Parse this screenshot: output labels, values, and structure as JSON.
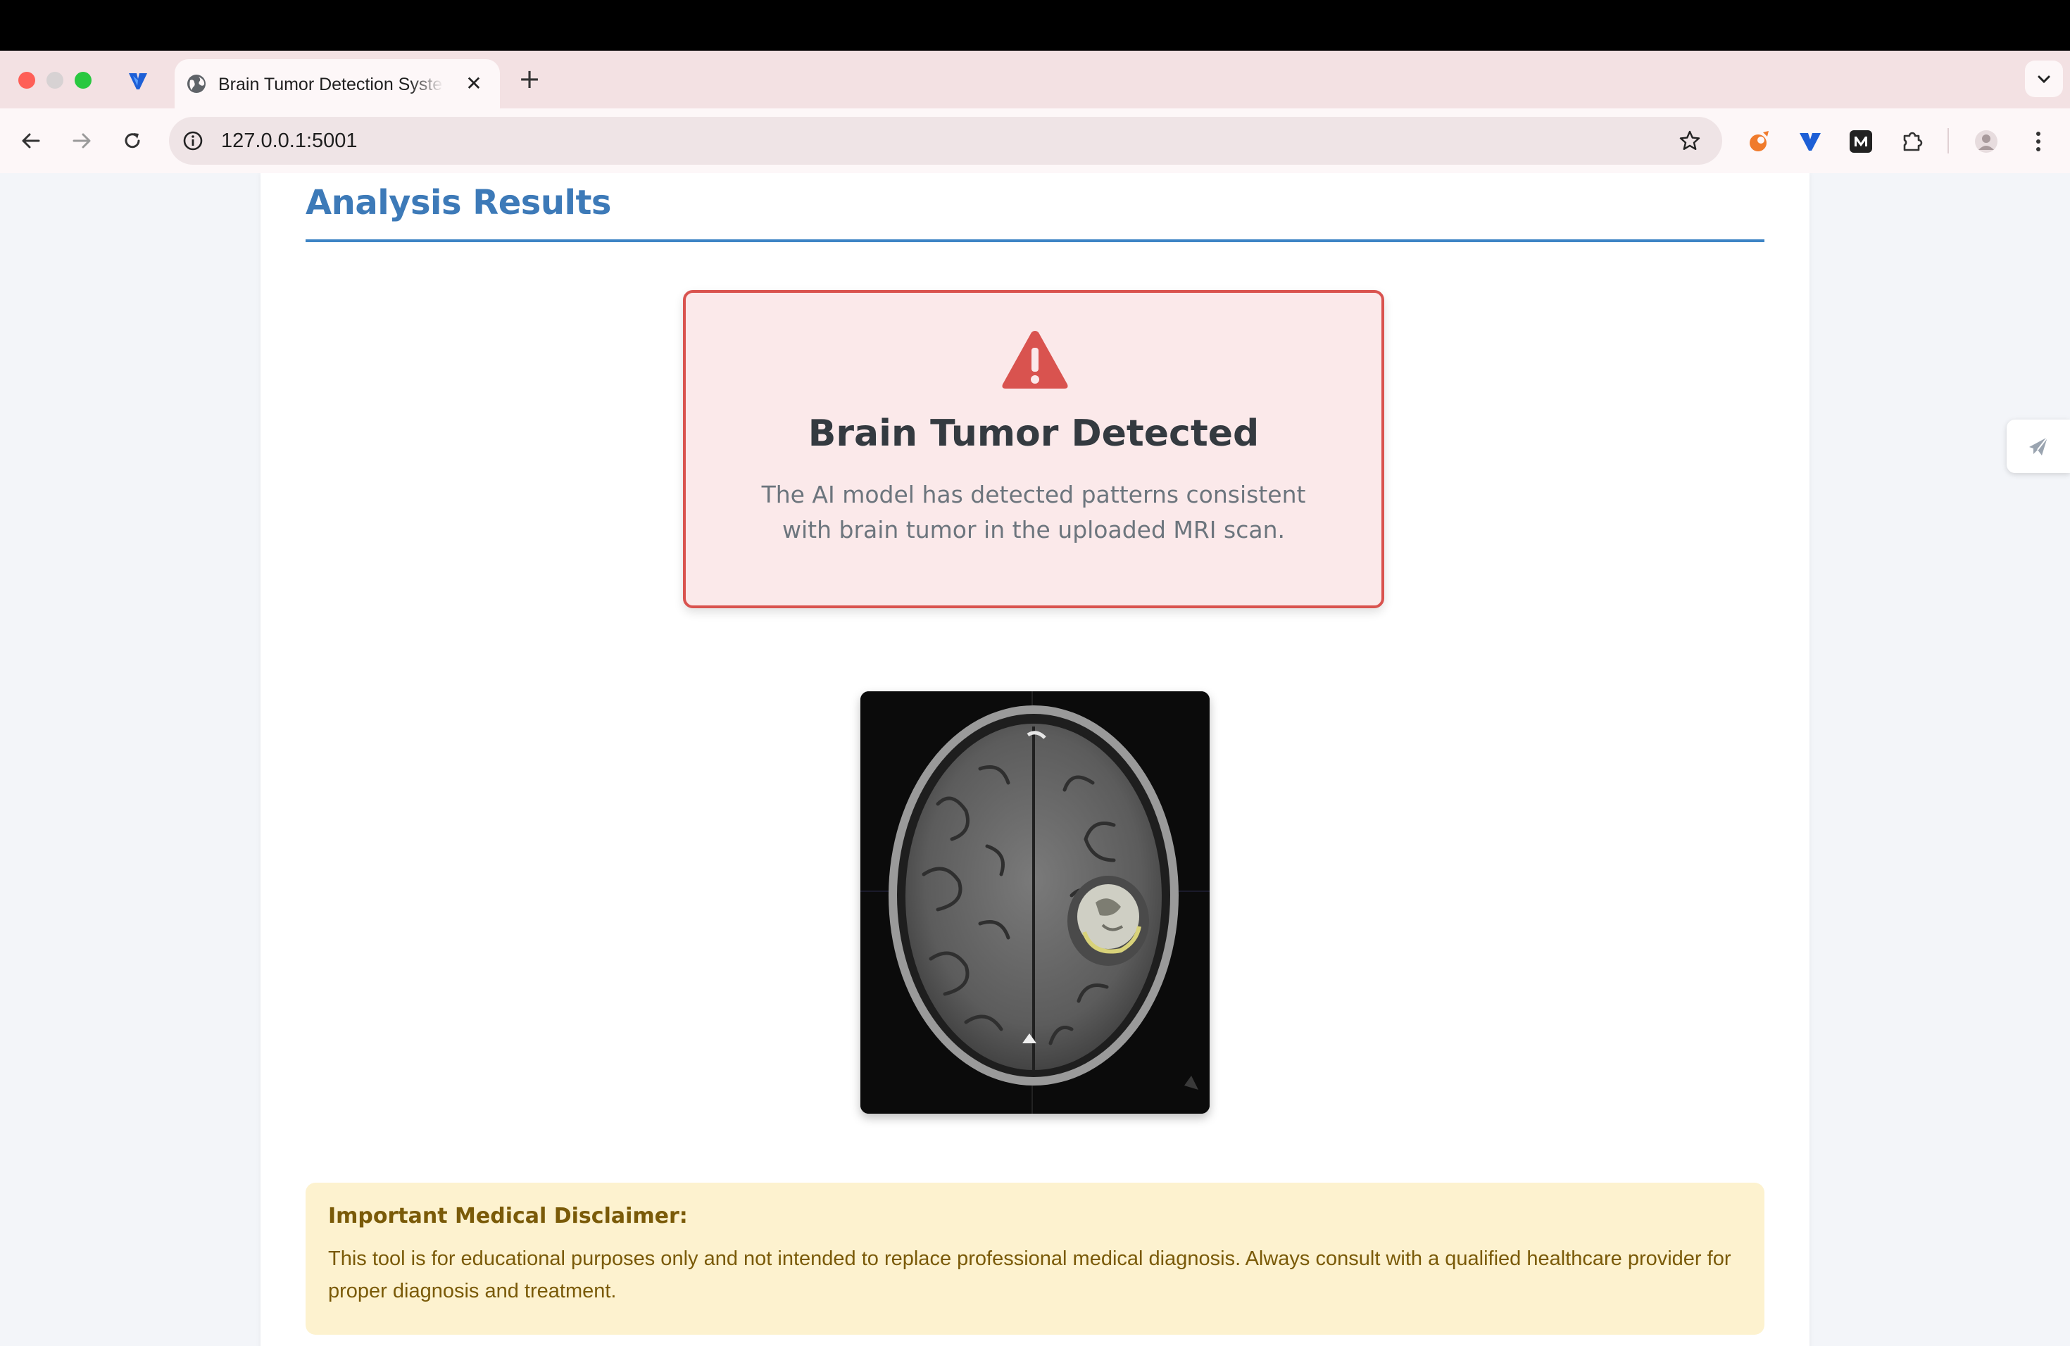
{
  "browser": {
    "tab_title": "Brain Tumor Detection System",
    "tab_close": "✕",
    "new_tab": "+",
    "url": "127.0.0.1:5001"
  },
  "page": {
    "section_title": "Analysis Results",
    "result": {
      "title": "Brain Tumor Detected",
      "description": "The AI model has detected patterns consistent with brain tumor in the uploaded MRI scan.",
      "status_color": "#d9534f"
    },
    "disclaimer": {
      "title": "Important Medical Disclaimer:",
      "text": "This tool is for educational purposes only and not intended to replace professional medical diagnosis. Always consult with a qualified healthcare provider for proper diagnosis and treatment."
    }
  },
  "icons": {
    "warning": "warning-triangle-icon",
    "back": "arrow-left-icon",
    "forward": "arrow-right-icon",
    "reload": "reload-icon",
    "info": "info-icon",
    "star": "star-icon",
    "extensions": "puzzle-icon",
    "menu": "kebab-menu-icon"
  }
}
